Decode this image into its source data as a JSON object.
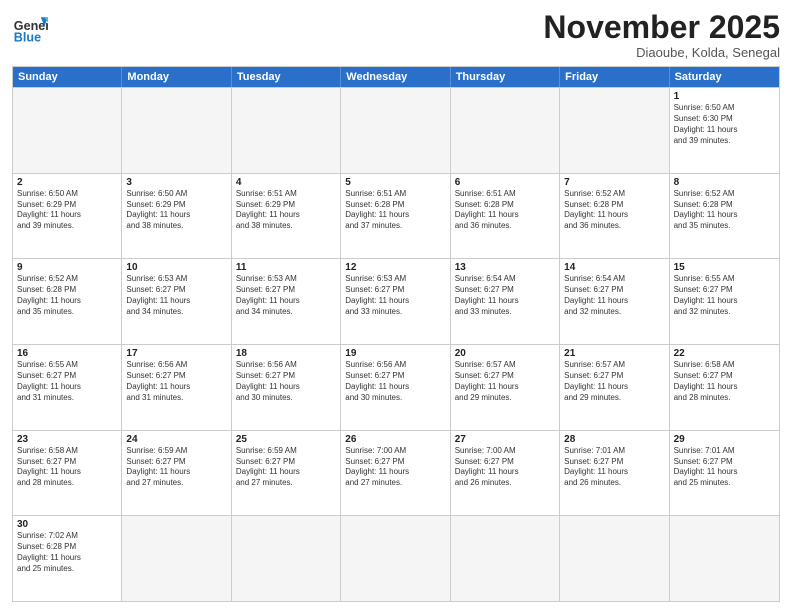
{
  "header": {
    "logo_general": "General",
    "logo_blue": "Blue",
    "month_title": "November 2025",
    "location": "Diaoube, Kolda, Senegal"
  },
  "days_of_week": [
    "Sunday",
    "Monday",
    "Tuesday",
    "Wednesday",
    "Thursday",
    "Friday",
    "Saturday"
  ],
  "weeks": [
    [
      {
        "day": "",
        "empty": true,
        "lines": []
      },
      {
        "day": "",
        "empty": true,
        "lines": []
      },
      {
        "day": "",
        "empty": true,
        "lines": []
      },
      {
        "day": "",
        "empty": true,
        "lines": []
      },
      {
        "day": "",
        "empty": true,
        "lines": []
      },
      {
        "day": "",
        "empty": true,
        "lines": []
      },
      {
        "day": "1",
        "empty": false,
        "lines": [
          "Sunrise: 6:50 AM",
          "Sunset: 6:30 PM",
          "Daylight: 11 hours",
          "and 39 minutes."
        ]
      }
    ],
    [
      {
        "day": "2",
        "empty": false,
        "lines": [
          "Sunrise: 6:50 AM",
          "Sunset: 6:29 PM",
          "Daylight: 11 hours",
          "and 39 minutes."
        ]
      },
      {
        "day": "3",
        "empty": false,
        "lines": [
          "Sunrise: 6:50 AM",
          "Sunset: 6:29 PM",
          "Daylight: 11 hours",
          "and 38 minutes."
        ]
      },
      {
        "day": "4",
        "empty": false,
        "lines": [
          "Sunrise: 6:51 AM",
          "Sunset: 6:29 PM",
          "Daylight: 11 hours",
          "and 38 minutes."
        ]
      },
      {
        "day": "5",
        "empty": false,
        "lines": [
          "Sunrise: 6:51 AM",
          "Sunset: 6:28 PM",
          "Daylight: 11 hours",
          "and 37 minutes."
        ]
      },
      {
        "day": "6",
        "empty": false,
        "lines": [
          "Sunrise: 6:51 AM",
          "Sunset: 6:28 PM",
          "Daylight: 11 hours",
          "and 36 minutes."
        ]
      },
      {
        "day": "7",
        "empty": false,
        "lines": [
          "Sunrise: 6:52 AM",
          "Sunset: 6:28 PM",
          "Daylight: 11 hours",
          "and 36 minutes."
        ]
      },
      {
        "day": "8",
        "empty": false,
        "lines": [
          "Sunrise: 6:52 AM",
          "Sunset: 6:28 PM",
          "Daylight: 11 hours",
          "and 35 minutes."
        ]
      }
    ],
    [
      {
        "day": "9",
        "empty": false,
        "lines": [
          "Sunrise: 6:52 AM",
          "Sunset: 6:28 PM",
          "Daylight: 11 hours",
          "and 35 minutes."
        ]
      },
      {
        "day": "10",
        "empty": false,
        "lines": [
          "Sunrise: 6:53 AM",
          "Sunset: 6:27 PM",
          "Daylight: 11 hours",
          "and 34 minutes."
        ]
      },
      {
        "day": "11",
        "empty": false,
        "lines": [
          "Sunrise: 6:53 AM",
          "Sunset: 6:27 PM",
          "Daylight: 11 hours",
          "and 34 minutes."
        ]
      },
      {
        "day": "12",
        "empty": false,
        "lines": [
          "Sunrise: 6:53 AM",
          "Sunset: 6:27 PM",
          "Daylight: 11 hours",
          "and 33 minutes."
        ]
      },
      {
        "day": "13",
        "empty": false,
        "lines": [
          "Sunrise: 6:54 AM",
          "Sunset: 6:27 PM",
          "Daylight: 11 hours",
          "and 33 minutes."
        ]
      },
      {
        "day": "14",
        "empty": false,
        "lines": [
          "Sunrise: 6:54 AM",
          "Sunset: 6:27 PM",
          "Daylight: 11 hours",
          "and 32 minutes."
        ]
      },
      {
        "day": "15",
        "empty": false,
        "lines": [
          "Sunrise: 6:55 AM",
          "Sunset: 6:27 PM",
          "Daylight: 11 hours",
          "and 32 minutes."
        ]
      }
    ],
    [
      {
        "day": "16",
        "empty": false,
        "lines": [
          "Sunrise: 6:55 AM",
          "Sunset: 6:27 PM",
          "Daylight: 11 hours",
          "and 31 minutes."
        ]
      },
      {
        "day": "17",
        "empty": false,
        "lines": [
          "Sunrise: 6:56 AM",
          "Sunset: 6:27 PM",
          "Daylight: 11 hours",
          "and 31 minutes."
        ]
      },
      {
        "day": "18",
        "empty": false,
        "lines": [
          "Sunrise: 6:56 AM",
          "Sunset: 6:27 PM",
          "Daylight: 11 hours",
          "and 30 minutes."
        ]
      },
      {
        "day": "19",
        "empty": false,
        "lines": [
          "Sunrise: 6:56 AM",
          "Sunset: 6:27 PM",
          "Daylight: 11 hours",
          "and 30 minutes."
        ]
      },
      {
        "day": "20",
        "empty": false,
        "lines": [
          "Sunrise: 6:57 AM",
          "Sunset: 6:27 PM",
          "Daylight: 11 hours",
          "and 29 minutes."
        ]
      },
      {
        "day": "21",
        "empty": false,
        "lines": [
          "Sunrise: 6:57 AM",
          "Sunset: 6:27 PM",
          "Daylight: 11 hours",
          "and 29 minutes."
        ]
      },
      {
        "day": "22",
        "empty": false,
        "lines": [
          "Sunrise: 6:58 AM",
          "Sunset: 6:27 PM",
          "Daylight: 11 hours",
          "and 28 minutes."
        ]
      }
    ],
    [
      {
        "day": "23",
        "empty": false,
        "lines": [
          "Sunrise: 6:58 AM",
          "Sunset: 6:27 PM",
          "Daylight: 11 hours",
          "and 28 minutes."
        ]
      },
      {
        "day": "24",
        "empty": false,
        "lines": [
          "Sunrise: 6:59 AM",
          "Sunset: 6:27 PM",
          "Daylight: 11 hours",
          "and 27 minutes."
        ]
      },
      {
        "day": "25",
        "empty": false,
        "lines": [
          "Sunrise: 6:59 AM",
          "Sunset: 6:27 PM",
          "Daylight: 11 hours",
          "and 27 minutes."
        ]
      },
      {
        "day": "26",
        "empty": false,
        "lines": [
          "Sunrise: 7:00 AM",
          "Sunset: 6:27 PM",
          "Daylight: 11 hours",
          "and 27 minutes."
        ]
      },
      {
        "day": "27",
        "empty": false,
        "lines": [
          "Sunrise: 7:00 AM",
          "Sunset: 6:27 PM",
          "Daylight: 11 hours",
          "and 26 minutes."
        ]
      },
      {
        "day": "28",
        "empty": false,
        "lines": [
          "Sunrise: 7:01 AM",
          "Sunset: 6:27 PM",
          "Daylight: 11 hours",
          "and 26 minutes."
        ]
      },
      {
        "day": "29",
        "empty": false,
        "lines": [
          "Sunrise: 7:01 AM",
          "Sunset: 6:27 PM",
          "Daylight: 11 hours",
          "and 25 minutes."
        ]
      }
    ],
    [
      {
        "day": "30",
        "empty": false,
        "lines": [
          "Sunrise: 7:02 AM",
          "Sunset: 6:28 PM",
          "Daylight: 11 hours",
          "and 25 minutes."
        ]
      },
      {
        "day": "",
        "empty": true,
        "lines": []
      },
      {
        "day": "",
        "empty": true,
        "lines": []
      },
      {
        "day": "",
        "empty": true,
        "lines": []
      },
      {
        "day": "",
        "empty": true,
        "lines": []
      },
      {
        "day": "",
        "empty": true,
        "lines": []
      },
      {
        "day": "",
        "empty": true,
        "lines": []
      }
    ]
  ]
}
